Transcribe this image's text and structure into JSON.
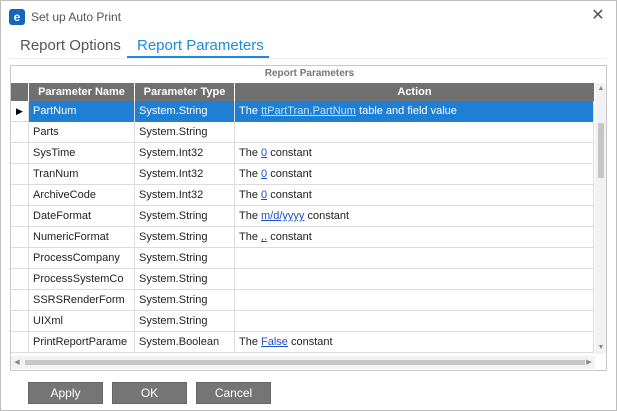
{
  "window": {
    "title": "Set up Auto Print",
    "app_icon_letter": "e",
    "close_glyph": "✕"
  },
  "tabs": [
    {
      "label": "Report Options",
      "active": false
    },
    {
      "label": "Report Parameters",
      "active": true
    }
  ],
  "grid": {
    "caption": "Report Parameters",
    "columns": [
      "Parameter Name",
      "Parameter Type",
      "Action"
    ],
    "rows": [
      {
        "name": "PartNum",
        "type": "System.String",
        "action": {
          "prefix": "The ",
          "link": "ttPartTran.PartNum",
          "suffix": " table and field value"
        },
        "selected": true
      },
      {
        "name": "Parts",
        "type": "System.String",
        "action": null
      },
      {
        "name": "SysTime",
        "type": "System.Int32",
        "action": {
          "prefix": "The ",
          "link": "0",
          "suffix": " constant"
        }
      },
      {
        "name": "TranNum",
        "type": "System.Int32",
        "action": {
          "prefix": "The ",
          "link": "0",
          "suffix": " constant"
        }
      },
      {
        "name": "ArchiveCode",
        "type": "System.Int32",
        "action": {
          "prefix": "The ",
          "link": "0",
          "suffix": " constant"
        }
      },
      {
        "name": "DateFormat",
        "type": "System.String",
        "action": {
          "prefix": "The ",
          "link": "m/d/yyyy",
          "suffix": " constant"
        }
      },
      {
        "name": "NumericFormat",
        "type": "System.String",
        "action": {
          "prefix": "The ",
          "link": ",.",
          "suffix": " constant"
        }
      },
      {
        "name": "ProcessCompany",
        "type": "System.String",
        "action": null
      },
      {
        "name": "ProcessSystemCo",
        "type": "System.String",
        "action": null
      },
      {
        "name": "SSRSRenderForm",
        "type": "System.String",
        "action": null
      },
      {
        "name": "UIXml",
        "type": "System.String",
        "action": null
      },
      {
        "name": "PrintReportParame",
        "type": "System.Boolean",
        "action": {
          "prefix": "The ",
          "link": "False",
          "suffix": " constant"
        }
      }
    ],
    "row_indicator": "▶"
  },
  "buttons": {
    "apply": "Apply",
    "ok": "OK",
    "cancel": "Cancel"
  },
  "colors": {
    "accent": "#1f8ad6",
    "selected_row": "#1f7fd4",
    "header_bg": "#707070",
    "button_bg": "#757575"
  }
}
